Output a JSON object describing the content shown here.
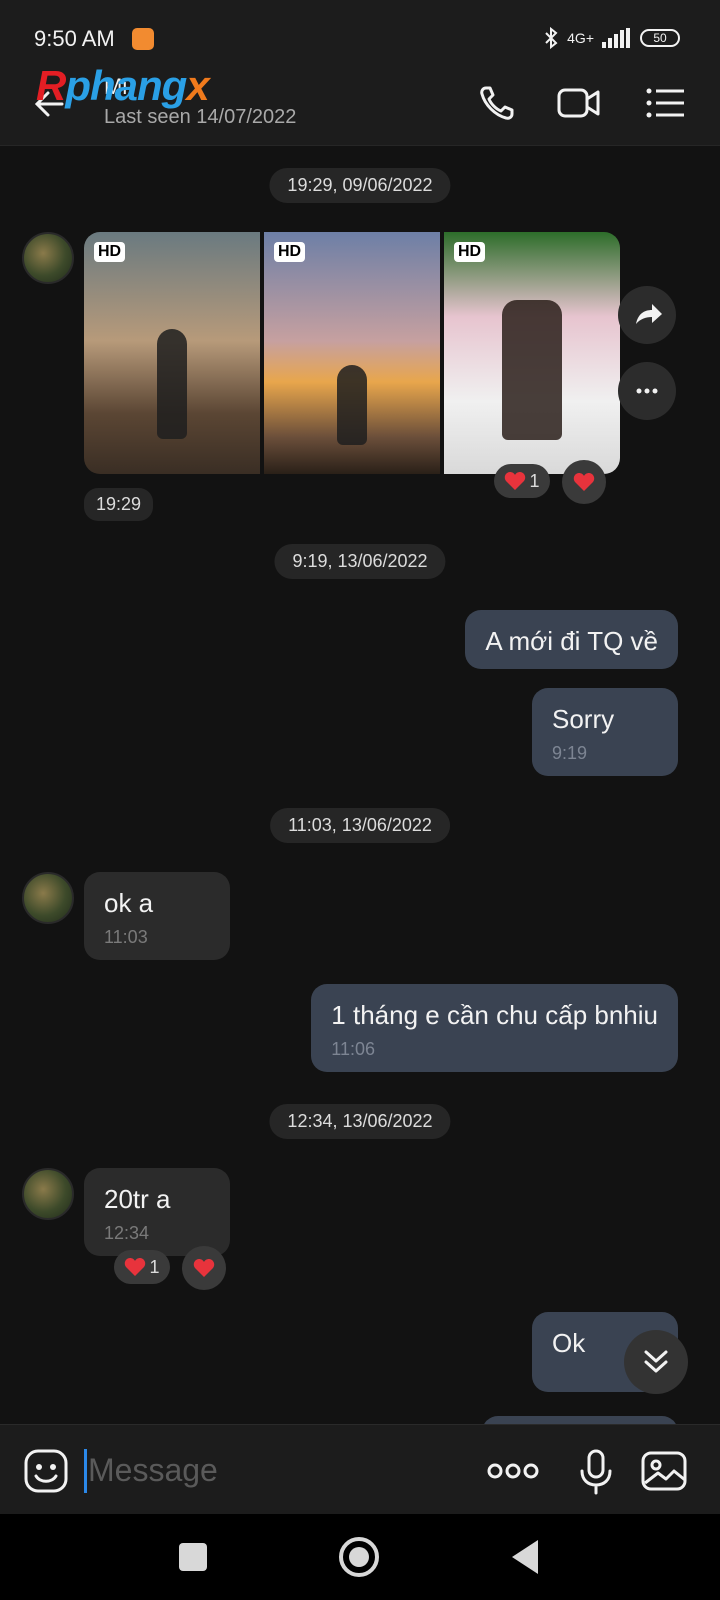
{
  "status_bar": {
    "time": "9:50 AM",
    "network": "4G+",
    "battery": "50"
  },
  "header": {
    "watermark": {
      "part1": "R",
      "part2": "phang",
      "part3": "x"
    },
    "contact_name": "Mi",
    "last_seen": "Last seen 14/07/2022",
    "icons": [
      "back-arrow-icon",
      "phone-icon",
      "video-call-icon",
      "menu-list-icon"
    ]
  },
  "chat": {
    "date_chips": [
      "19:29, 09/06/2022",
      "9:19, 13/06/2022",
      "11:03, 13/06/2022",
      "12:34, 13/06/2022"
    ],
    "photo_album": {
      "badges": [
        "HD",
        "HD",
        "HD"
      ],
      "time": "19:29",
      "reaction_count": "1"
    },
    "messages": [
      {
        "dir": "out",
        "text": "A mới đi TQ về",
        "time": ""
      },
      {
        "dir": "out",
        "text": "Sorry",
        "time": "9:19"
      },
      {
        "dir": "in",
        "text": "ok a",
        "time": "11:03"
      },
      {
        "dir": "out",
        "text": "1 tháng e cần chu cấp bnhiu",
        "time": "11:06"
      },
      {
        "dir": "in",
        "text": "20tr a",
        "time": "12:34",
        "reaction_count": "1"
      },
      {
        "dir": "out",
        "text": "Ok",
        "time": ""
      }
    ]
  },
  "composer": {
    "placeholder": "Message",
    "icons": [
      "emoji-icon",
      "more-dots-icon",
      "microphone-icon",
      "gallery-icon"
    ]
  },
  "navbar": {
    "icons": [
      "recent-apps-icon",
      "home-icon",
      "back-triangle-icon"
    ]
  },
  "colors": {
    "background": "#121212",
    "bubble_out": "#3a4352",
    "bubble_in": "#2b2b2b",
    "accent": "#2b88e8"
  }
}
